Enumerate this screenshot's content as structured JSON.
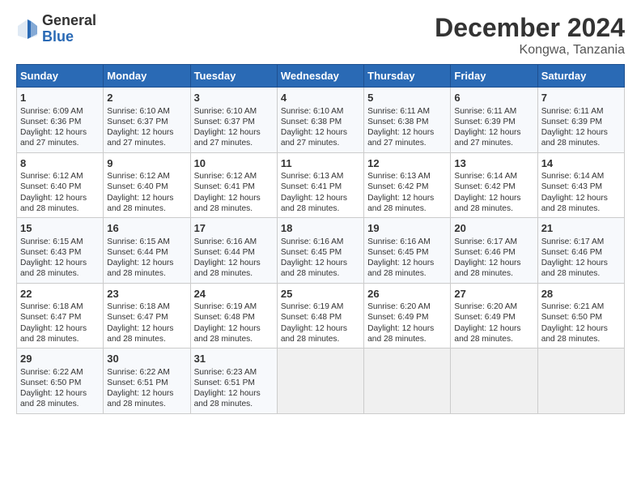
{
  "header": {
    "logo_general": "General",
    "logo_blue": "Blue",
    "title": "December 2024",
    "subtitle": "Kongwa, Tanzania"
  },
  "days_of_week": [
    "Sunday",
    "Monday",
    "Tuesday",
    "Wednesday",
    "Thursday",
    "Friday",
    "Saturday"
  ],
  "weeks": [
    [
      {
        "day": "1",
        "lines": [
          "Sunrise: 6:09 AM",
          "Sunset: 6:36 PM",
          "Daylight: 12 hours",
          "and 27 minutes."
        ]
      },
      {
        "day": "2",
        "lines": [
          "Sunrise: 6:10 AM",
          "Sunset: 6:37 PM",
          "Daylight: 12 hours",
          "and 27 minutes."
        ]
      },
      {
        "day": "3",
        "lines": [
          "Sunrise: 6:10 AM",
          "Sunset: 6:37 PM",
          "Daylight: 12 hours",
          "and 27 minutes."
        ]
      },
      {
        "day": "4",
        "lines": [
          "Sunrise: 6:10 AM",
          "Sunset: 6:38 PM",
          "Daylight: 12 hours",
          "and 27 minutes."
        ]
      },
      {
        "day": "5",
        "lines": [
          "Sunrise: 6:11 AM",
          "Sunset: 6:38 PM",
          "Daylight: 12 hours",
          "and 27 minutes."
        ]
      },
      {
        "day": "6",
        "lines": [
          "Sunrise: 6:11 AM",
          "Sunset: 6:39 PM",
          "Daylight: 12 hours",
          "and 27 minutes."
        ]
      },
      {
        "day": "7",
        "lines": [
          "Sunrise: 6:11 AM",
          "Sunset: 6:39 PM",
          "Daylight: 12 hours",
          "and 28 minutes."
        ]
      }
    ],
    [
      {
        "day": "8",
        "lines": [
          "Sunrise: 6:12 AM",
          "Sunset: 6:40 PM",
          "Daylight: 12 hours",
          "and 28 minutes."
        ]
      },
      {
        "day": "9",
        "lines": [
          "Sunrise: 6:12 AM",
          "Sunset: 6:40 PM",
          "Daylight: 12 hours",
          "and 28 minutes."
        ]
      },
      {
        "day": "10",
        "lines": [
          "Sunrise: 6:12 AM",
          "Sunset: 6:41 PM",
          "Daylight: 12 hours",
          "and 28 minutes."
        ]
      },
      {
        "day": "11",
        "lines": [
          "Sunrise: 6:13 AM",
          "Sunset: 6:41 PM",
          "Daylight: 12 hours",
          "and 28 minutes."
        ]
      },
      {
        "day": "12",
        "lines": [
          "Sunrise: 6:13 AM",
          "Sunset: 6:42 PM",
          "Daylight: 12 hours",
          "and 28 minutes."
        ]
      },
      {
        "day": "13",
        "lines": [
          "Sunrise: 6:14 AM",
          "Sunset: 6:42 PM",
          "Daylight: 12 hours",
          "and 28 minutes."
        ]
      },
      {
        "day": "14",
        "lines": [
          "Sunrise: 6:14 AM",
          "Sunset: 6:43 PM",
          "Daylight: 12 hours",
          "and 28 minutes."
        ]
      }
    ],
    [
      {
        "day": "15",
        "lines": [
          "Sunrise: 6:15 AM",
          "Sunset: 6:43 PM",
          "Daylight: 12 hours",
          "and 28 minutes."
        ]
      },
      {
        "day": "16",
        "lines": [
          "Sunrise: 6:15 AM",
          "Sunset: 6:44 PM",
          "Daylight: 12 hours",
          "and 28 minutes."
        ]
      },
      {
        "day": "17",
        "lines": [
          "Sunrise: 6:16 AM",
          "Sunset: 6:44 PM",
          "Daylight: 12 hours",
          "and 28 minutes."
        ]
      },
      {
        "day": "18",
        "lines": [
          "Sunrise: 6:16 AM",
          "Sunset: 6:45 PM",
          "Daylight: 12 hours",
          "and 28 minutes."
        ]
      },
      {
        "day": "19",
        "lines": [
          "Sunrise: 6:16 AM",
          "Sunset: 6:45 PM",
          "Daylight: 12 hours",
          "and 28 minutes."
        ]
      },
      {
        "day": "20",
        "lines": [
          "Sunrise: 6:17 AM",
          "Sunset: 6:46 PM",
          "Daylight: 12 hours",
          "and 28 minutes."
        ]
      },
      {
        "day": "21",
        "lines": [
          "Sunrise: 6:17 AM",
          "Sunset: 6:46 PM",
          "Daylight: 12 hours",
          "and 28 minutes."
        ]
      }
    ],
    [
      {
        "day": "22",
        "lines": [
          "Sunrise: 6:18 AM",
          "Sunset: 6:47 PM",
          "Daylight: 12 hours",
          "and 28 minutes."
        ]
      },
      {
        "day": "23",
        "lines": [
          "Sunrise: 6:18 AM",
          "Sunset: 6:47 PM",
          "Daylight: 12 hours",
          "and 28 minutes."
        ]
      },
      {
        "day": "24",
        "lines": [
          "Sunrise: 6:19 AM",
          "Sunset: 6:48 PM",
          "Daylight: 12 hours",
          "and 28 minutes."
        ]
      },
      {
        "day": "25",
        "lines": [
          "Sunrise: 6:19 AM",
          "Sunset: 6:48 PM",
          "Daylight: 12 hours",
          "and 28 minutes."
        ]
      },
      {
        "day": "26",
        "lines": [
          "Sunrise: 6:20 AM",
          "Sunset: 6:49 PM",
          "Daylight: 12 hours",
          "and 28 minutes."
        ]
      },
      {
        "day": "27",
        "lines": [
          "Sunrise: 6:20 AM",
          "Sunset: 6:49 PM",
          "Daylight: 12 hours",
          "and 28 minutes."
        ]
      },
      {
        "day": "28",
        "lines": [
          "Sunrise: 6:21 AM",
          "Sunset: 6:50 PM",
          "Daylight: 12 hours",
          "and 28 minutes."
        ]
      }
    ],
    [
      {
        "day": "29",
        "lines": [
          "Sunrise: 6:22 AM",
          "Sunset: 6:50 PM",
          "Daylight: 12 hours",
          "and 28 minutes."
        ]
      },
      {
        "day": "30",
        "lines": [
          "Sunrise: 6:22 AM",
          "Sunset: 6:51 PM",
          "Daylight: 12 hours",
          "and 28 minutes."
        ]
      },
      {
        "day": "31",
        "lines": [
          "Sunrise: 6:23 AM",
          "Sunset: 6:51 PM",
          "Daylight: 12 hours",
          "and 28 minutes."
        ]
      },
      {
        "day": "",
        "lines": []
      },
      {
        "day": "",
        "lines": []
      },
      {
        "day": "",
        "lines": []
      },
      {
        "day": "",
        "lines": []
      }
    ]
  ]
}
